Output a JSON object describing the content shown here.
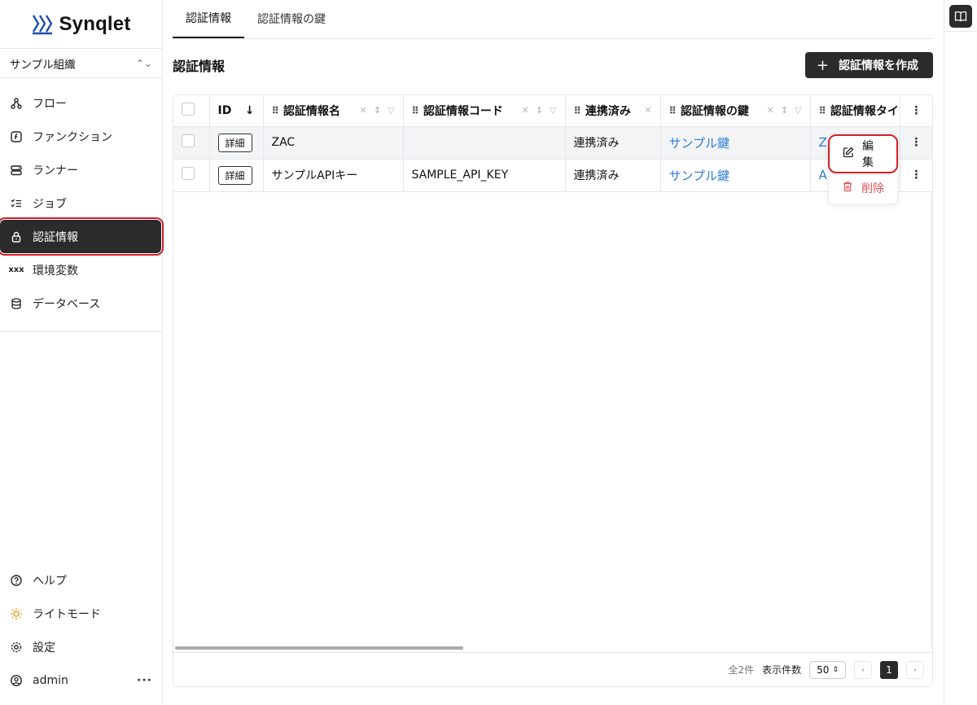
{
  "brand": {
    "name": "Synqlet"
  },
  "org": {
    "name": "サンプル組織"
  },
  "nav": {
    "items": [
      {
        "label": "フロー",
        "icon": "flow-icon"
      },
      {
        "label": "ファンクション",
        "icon": "function-icon"
      },
      {
        "label": "ランナー",
        "icon": "runner-icon"
      },
      {
        "label": "ジョブ",
        "icon": "job-list-icon"
      },
      {
        "label": "認証情報",
        "icon": "lock-icon",
        "active": true
      },
      {
        "label": "環境変数",
        "icon": "xxx-icon"
      },
      {
        "label": "データベース",
        "icon": "database-icon"
      }
    ],
    "bottom": [
      {
        "label": "ヘルプ",
        "icon": "help-icon"
      },
      {
        "label": "ライトモード",
        "icon": "sun-icon"
      },
      {
        "label": "設定",
        "icon": "gear-icon"
      },
      {
        "label": "admin",
        "icon": "user-icon",
        "more": "···"
      }
    ]
  },
  "tabs": [
    {
      "label": "認証情報",
      "active": true
    },
    {
      "label": "認証情報の鍵",
      "active": false
    }
  ],
  "page": {
    "title": "認証情報",
    "create_label": "認証情報を作成",
    "create_icon": "+"
  },
  "table": {
    "columns": [
      "ID",
      "認証情報名",
      "認証情報コード",
      "連携済み",
      "認証情報の鍵",
      "認証情報タイ"
    ],
    "id_sort": "↓",
    "rows": [
      {
        "detail": "詳細",
        "name": "ZAC",
        "code": "",
        "linked": "連携済み",
        "key": "サンプル鍵",
        "type": "Z"
      },
      {
        "detail": "詳細",
        "name": "サンプルAPIキー",
        "code": "SAMPLE_API_KEY",
        "linked": "連携済み",
        "key": "サンプル鍵",
        "type": "A"
      }
    ]
  },
  "context_menu": {
    "edit": "編集",
    "delete": "削除"
  },
  "pagination": {
    "total": "全2件",
    "per_page_label": "表示件数",
    "per_page": "50",
    "current_page": "1",
    "prev": "‹",
    "next": "›"
  },
  "colors": {
    "accent_dark": "#2b2b2b",
    "link": "#2a7bd6",
    "danger": "#e05555",
    "highlight": "#d11f2a"
  }
}
